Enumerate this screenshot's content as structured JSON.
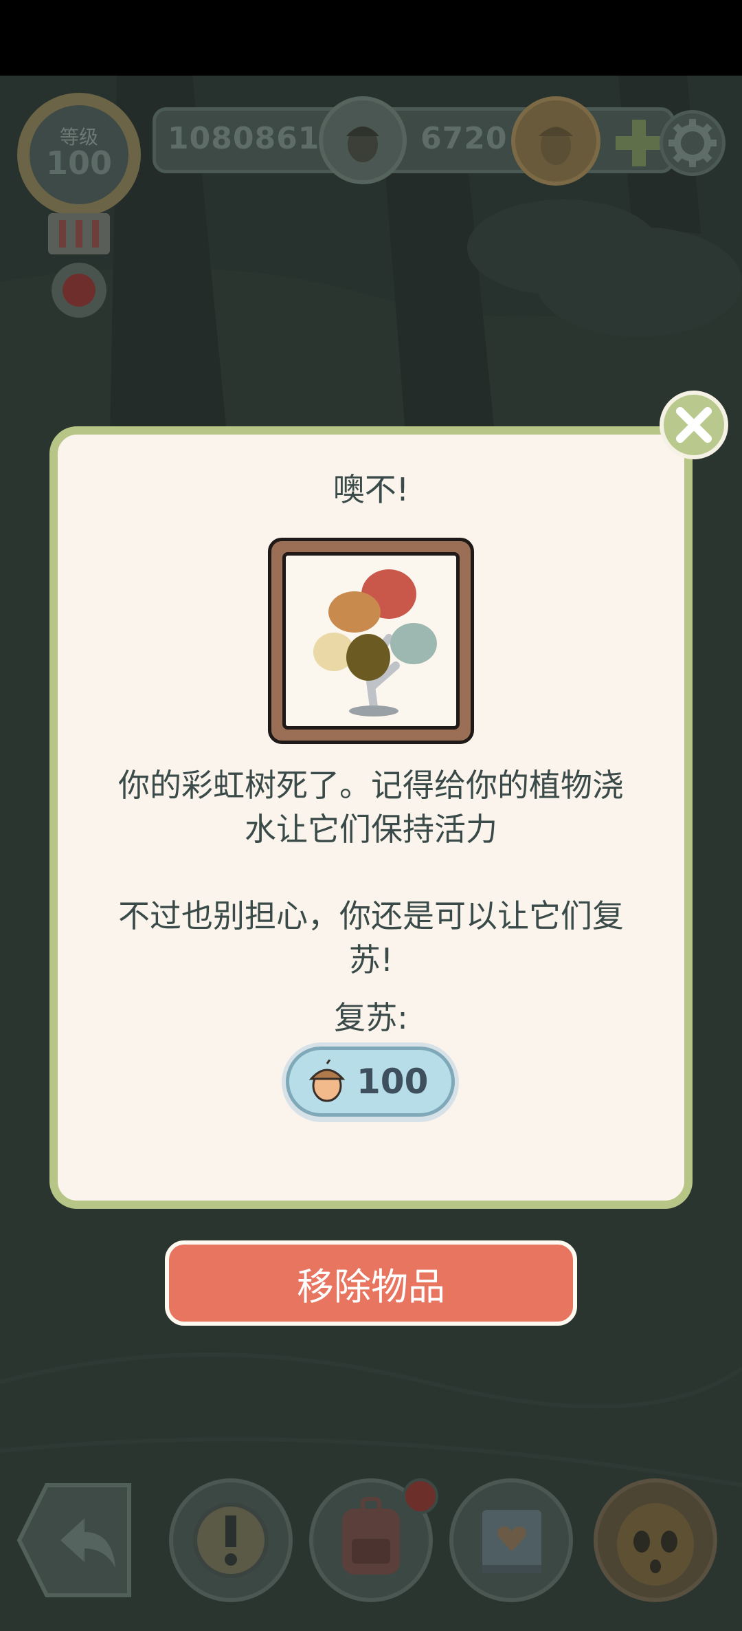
{
  "hud": {
    "level_label": "等级",
    "level_value": "100",
    "primary_currency": "1080861",
    "secondary_currency": "6720"
  },
  "dialog": {
    "title": "噢不!",
    "body_line1": "你的彩虹树死了。记得给你的植物浇",
    "body_line2": "水让它们保持活力",
    "body_line3": "不过也别担心，你还是可以让它们复",
    "body_line4": "苏!",
    "revive_label": "复苏:",
    "revive_cost": "100"
  },
  "remove_button": {
    "label": "移除物品"
  },
  "colors": {
    "dialog_border": "#b7c586",
    "dialog_bg": "#faf4ec",
    "remove_button": "#e87560",
    "revive_button": "#b6dde8",
    "text": "#3a4a48"
  },
  "icons": {
    "close": "close-icon",
    "acorn": "acorn-icon",
    "settings": "gear-icon",
    "back": "back-arrow-icon",
    "alert": "exclamation-icon",
    "backpack": "backpack-icon",
    "book": "heart-book-icon",
    "character": "acorn-character-icon"
  }
}
